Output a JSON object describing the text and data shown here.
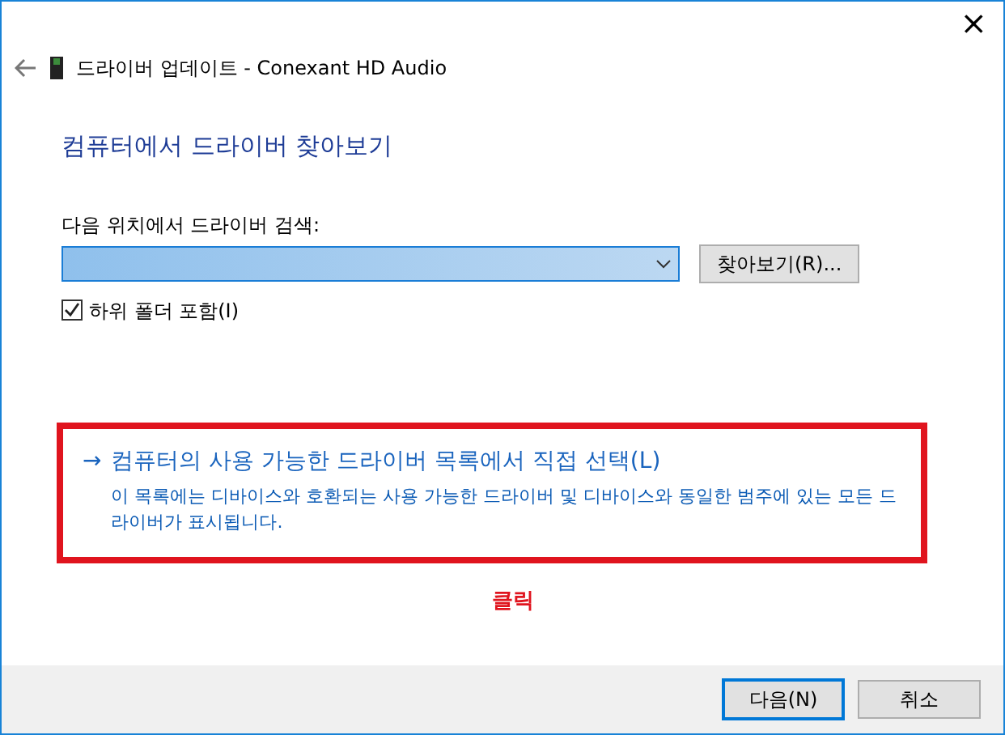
{
  "window": {
    "title": "드라이버 업데이트 - Conexant HD Audio",
    "close": "×"
  },
  "heading": "컴퓨터에서 드라이버 찾아보기",
  "search": {
    "label": "다음 위치에서 드라이버 검색:",
    "highlighted": true,
    "browse_button": "찾아보기(R)..."
  },
  "subfolders": {
    "label": "하위 폴더 포함(I)",
    "checked": true
  },
  "option": {
    "arrow": "→",
    "title": "컴퓨터의 사용 가능한 드라이버 목록에서 직접 선택(L)",
    "description": "이 목록에는 디바이스와 호환되는 사용 가능한 드라이버 및 디바이스와 동일한 범주에 있는 모든 드라이버가 표시됩니다.",
    "annotated": true
  },
  "annotation": "클릭",
  "buttons": [
    {
      "label": "다음(N)",
      "default": true
    },
    {
      "label": "취소",
      "default": false
    }
  ]
}
